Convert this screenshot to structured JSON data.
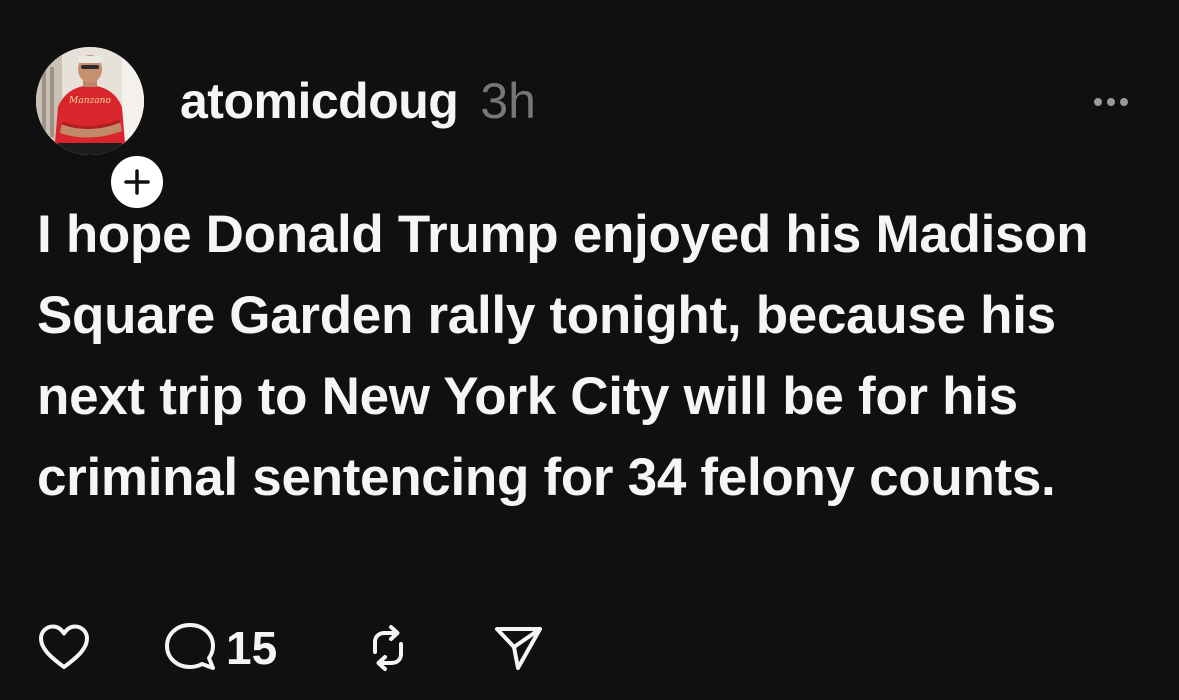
{
  "post": {
    "username": "atomicdoug",
    "time": "3h",
    "text": "I hope Donald Trump enjoyed his Madison Square Garden rally tonight, because his next trip to New York City will be for his criminal sentencing for 34 felony counts.",
    "avatar_shirt_text": "Manzano",
    "reply_count": "15"
  },
  "icons": {
    "follow": "plus-icon",
    "more": "more-horizontal-icon",
    "like": "heart-icon",
    "reply": "comment-icon",
    "repost": "repost-icon",
    "share": "send-icon"
  },
  "colors": {
    "background": "#101010",
    "text": "#f3f5f7",
    "secondary": "#777777",
    "avatar_shirt": "#d8262c"
  }
}
